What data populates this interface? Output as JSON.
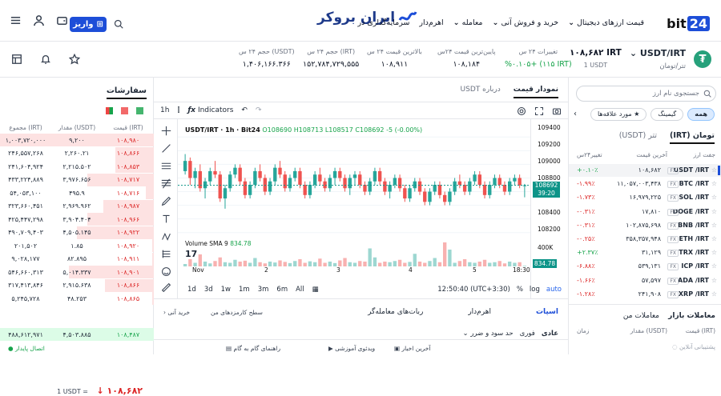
{
  "header": {
    "brand": "bit24",
    "partner_logo": "ایران بروکر",
    "menu": [
      "قیمت ارزهای دیجیتال",
      "خرید و فروش آنی",
      "معامله",
      "اهرم‌دار",
      "سرمایه‌گذاری در"
    ],
    "deposit_label": "واریز",
    "icons": [
      "menu-icon",
      "user-icon",
      "wallet-icon",
      "search-icon"
    ]
  },
  "ticker": {
    "symbol": "USDT/IRT",
    "name": "تتر/تومان",
    "price": "۱۰۸,۶۸۲ IRT",
    "price_usd": "1 USDT",
    "stats": [
      {
        "label": "تغییرات ۲۴ س",
        "value": "%۰.۱۰۵+ (۱۱۵ IRT)",
        "positive": true
      },
      {
        "label": "پایین‌ترین قیمت ۲۴س",
        "value": "۱۰۸,۱۸۴"
      },
      {
        "label": "بالاترین قیمت ۲۴ س",
        "value": "۱۰۸,۹۱۱"
      },
      {
        "label": "حجم ۲۴ س (IRT)",
        "value": "۱۵۲,۷۸۴,۷۲۹,۵۵۵"
      },
      {
        "label": "حجم ۲۴ س (USDT)",
        "value": "۱,۴۰۶,۱۶۶.۳۶۶"
      }
    ]
  },
  "orderbook": {
    "title": "سفارشات",
    "headers": [
      "قیمت (IRT)",
      "مقدار (USDT)",
      "مجموع (IRT)"
    ],
    "asks": [
      [
        "۱۰۸,۹۸۰",
        "۹,۲۰۰",
        "۱,۰۰۳,۷۲۰,۰۰۰"
      ],
      [
        "۱۰۸,۸۶۶",
        "۲,۲۶۰.۲۱",
        "۲۴۶,۵۵۷,۲۶۸"
      ],
      [
        "۱۰۸,۸۵۳",
        "۲,۲۱۵.۵۰۲",
        "۲۴۱,۶۰۴,۹۲۴"
      ],
      [
        "۱۰۸,۷۱۷",
        "۳,۹۷۶.۶۵۶",
        "۴۳۳,۲۲۴,۸۸۹"
      ],
      [
        "۱۰۸,۷۱۶",
        "۴۹۵.۹",
        "۵۴,۰۵۳,۱۰۰"
      ],
      [
        "۱۰۸,۹۸۷",
        "۲,۹۶۹.۹۶۲",
        "۳۲۳,۶۶۰,۴۵۱"
      ],
      [
        "۱۰۸,۹۶۶",
        "۳,۹۰۴.۴۰۴",
        "۴۲۵,۴۴۷,۲۹۸"
      ],
      [
        "۱۰۸,۹۲۲",
        "۴,۵۰۵.۱۴۵",
        "۴۹۰,۷۰۹,۴۰۳"
      ],
      [
        "۱۰۸,۹۲۰",
        "۱.۸۵",
        "۲۰۱,۵۰۲"
      ],
      [
        "۱۰۸,۹۱۱",
        "۸۲.۸۹۵",
        "۹,۰۲۸,۱۷۷"
      ],
      [
        "۱۰۸,۹۰۱",
        "۵,۰۱۴.۳۳۷",
        "۵۴۶,۶۶۰,۳۱۳"
      ],
      [
        "۱۰۸,۸۶۶",
        "۲,۹۱۵.۶۳۸",
        "۳۱۷,۴۱۳,۸۴۶"
      ],
      [
        "۱۰۸,۸۶۵",
        "۴۸.۲۵۳",
        "۵,۲۴۵,۷۲۸"
      ]
    ],
    "mid_price": "۱۰۸,۶۸۲",
    "mid_usdt": "1 USDT =",
    "bid": [
      "۱۰۸,۴۸۷",
      "۴,۵۰۳.۸۸۵",
      "۴۸۸,۶۱۲,۹۷۱"
    ]
  },
  "chart_panel": {
    "tabs": [
      "نمودار قیمت",
      "درباره USDT"
    ],
    "interval": "1h",
    "indicators_label": "Indicators",
    "legend": {
      "title": "USDT/IRT · 1h · Bit24",
      "o": "O108690",
      "h": "H108713",
      "l": "L108517",
      "c": "C108692",
      "chg": "-5 (-0.00%)"
    },
    "volume_legend": {
      "label": "Volume",
      "sma": "SMA 9",
      "value": "834.78"
    },
    "price_axis": [
      "109400",
      "109200",
      "109000",
      "108800",
      "108600",
      "108400",
      "108200",
      "108000"
    ],
    "current_price": "108692",
    "countdown": "39:20",
    "volume_axis": "400K",
    "volume_current": "834.78",
    "time_labels": [
      "Nov",
      "2",
      "3",
      "4",
      "5",
      "18:30"
    ],
    "ranges": [
      "1d",
      "3d",
      "1w",
      "1m",
      "3m",
      "6m",
      "All"
    ],
    "clock": "12:50:40 (UTC+3:30)",
    "percent_label": "%",
    "log_label": "log",
    "auto_label": "auto"
  },
  "chart_data": {
    "type": "candlestick",
    "ylim": [
      107950,
      109450
    ],
    "candles": [
      [
        108900,
        109150,
        108850,
        109050
      ],
      [
        109050,
        109100,
        108700,
        108800
      ],
      [
        108800,
        108950,
        108650,
        108900
      ],
      [
        108900,
        109000,
        108600,
        108650
      ],
      [
        108650,
        108800,
        108500,
        108750
      ],
      [
        108750,
        108950,
        108700,
        108900
      ],
      [
        108900,
        109050,
        108800,
        108850
      ],
      [
        108850,
        108900,
        108450,
        108500
      ],
      [
        108500,
        108700,
        108350,
        108650
      ],
      [
        108650,
        108900,
        108600,
        108850
      ],
      [
        108850,
        109000,
        108800,
        108950
      ],
      [
        108950,
        109000,
        108700,
        108750
      ],
      [
        108750,
        108800,
        108500,
        108550
      ],
      [
        108550,
        108750,
        108500,
        108700
      ],
      [
        108700,
        108950,
        108650,
        108900
      ],
      [
        108900,
        109000,
        108750,
        108800
      ],
      [
        108800,
        108850,
        108550,
        108600
      ],
      [
        108600,
        108800,
        108550,
        108750
      ],
      [
        108750,
        109000,
        108700,
        108950
      ],
      [
        108950,
        109050,
        108800,
        108850
      ],
      [
        108850,
        108900,
        108600,
        108650
      ],
      [
        108650,
        108850,
        108600,
        108800
      ],
      [
        108800,
        108950,
        108750,
        108900
      ],
      [
        108900,
        108950,
        108650,
        108700
      ],
      [
        108700,
        108750,
        108500,
        108550
      ],
      [
        108550,
        108750,
        108500,
        108700
      ],
      [
        108700,
        108900,
        108650,
        108850
      ],
      [
        108850,
        108950,
        108700,
        108750
      ],
      [
        108750,
        108800,
        108600,
        108650
      ],
      [
        108650,
        108850,
        108600,
        108800
      ],
      [
        108800,
        108950,
        108700,
        108900
      ],
      [
        108900,
        108950,
        108750,
        108800
      ],
      [
        108800,
        108850,
        108600,
        108650
      ],
      [
        108650,
        108850,
        108550,
        108800
      ],
      [
        108800,
        108900,
        108700,
        108850
      ],
      [
        108850,
        108900,
        108650,
        108700
      ],
      [
        108700,
        108750,
        108550,
        108600
      ],
      [
        108600,
        108800,
        108550,
        108750
      ],
      [
        108750,
        108950,
        108700,
        108900
      ],
      [
        108900,
        108950,
        108700,
        108750
      ],
      [
        108750,
        108800,
        108550,
        108600
      ],
      [
        108600,
        108750,
        108500,
        108700
      ],
      [
        108700,
        108850,
        108650,
        108800
      ],
      [
        108800,
        108850,
        108600,
        108650
      ],
      [
        108650,
        108700,
        108450,
        108500
      ],
      [
        108500,
        108700,
        108450,
        108650
      ],
      [
        108650,
        108800,
        108600,
        108750
      ],
      [
        108750,
        108800,
        108550,
        108600
      ],
      [
        108600,
        108650,
        108400,
        108450
      ],
      [
        108450,
        108650,
        108400,
        108600
      ],
      [
        108600,
        108750,
        108550,
        108700
      ],
      [
        108700,
        108750,
        108500,
        108550
      ],
      [
        108550,
        108600,
        108400,
        108450
      ],
      [
        108450,
        108650,
        108400,
        108600
      ],
      [
        108600,
        108800,
        108550,
        108750
      ],
      [
        108750,
        108850,
        108650,
        108700
      ],
      [
        108700,
        108750,
        108550,
        108600
      ],
      [
        108600,
        108800,
        108550,
        108750
      ],
      [
        108750,
        108900,
        108700,
        108850
      ],
      [
        108850,
        108900,
        108650,
        108700
      ],
      [
        108700,
        108750,
        108500,
        108550
      ],
      [
        108550,
        108750,
        108500,
        108700
      ],
      [
        108700,
        108850,
        108650,
        108800
      ],
      [
        108800,
        108850,
        108650,
        108700
      ],
      [
        108700,
        108750,
        108550,
        108600
      ],
      [
        108600,
        108800,
        108550,
        108750
      ],
      [
        108750,
        108850,
        108700,
        108800
      ],
      [
        108800,
        108850,
        108650,
        108692
      ],
      [
        108692,
        108713,
        108517,
        108692
      ]
    ],
    "volume": [
      40,
      120,
      60,
      200,
      80,
      50,
      90,
      150,
      70,
      60,
      110,
      80,
      95,
      60,
      140,
      70,
      50,
      80,
      65,
      100,
      75,
      55,
      90,
      120,
      60,
      85,
      70,
      130,
      60,
      80,
      55,
      100,
      140,
      70,
      60,
      90,
      80,
      300,
      150,
      60,
      80,
      70,
      90,
      110,
      60,
      75,
      210,
      80,
      60,
      90,
      140,
      70,
      400,
      280,
      60,
      90,
      120,
      70,
      60,
      80,
      110,
      60,
      70,
      90,
      50,
      80,
      60,
      70,
      10
    ],
    "colors": {
      "up": "#26a69a",
      "down": "#ef5350"
    }
  },
  "bottom": {
    "tabs": [
      "اسپات",
      "اهرم‌دار",
      "ربات‌های معامله‌گر",
      "سطح کارمزدهای من"
    ],
    "instant": "خرید آنی",
    "order_types": [
      "عادی",
      "فوری",
      "حد سود و ضرر"
    ],
    "footer": [
      "پشتیبانی آنلاین",
      "آخرین اخبار",
      "ویدئوی آموزشی",
      "راهنمای گام به گام",
      "اتصال پایدار"
    ]
  },
  "market": {
    "search_placeholder": "جستجوی نام ارز",
    "chips": [
      "همه",
      "گیمینگ",
      "مورد علاقه‌ها"
    ],
    "tabs": [
      "تومان (IRT)",
      "تتر (USDT)"
    ],
    "headers": [
      "جفت ارز",
      "آخرین قیمت",
      "تغییر۲۴س"
    ],
    "rows": [
      {
        "pair": "USDT /IRT",
        "price": "۱۰۸,۶۸۲",
        "change": "+۰.۱۰٪",
        "up": true
      },
      {
        "pair": "BTC /IRT",
        "price": "۱۱,۰۵۷,۰۰۳,۴۳۸",
        "change": "-۱.۹۹٪",
        "up": false
      },
      {
        "pair": "SOL /IRT",
        "price": "۱۶,۹۷۹,۲۲۵",
        "change": "-۱.۷۳٪",
        "up": false
      },
      {
        "pair": "DOGE /IRT",
        "price": "۱۷,۸۱۰",
        "change": "-۰.۳۱٪",
        "up": false
      },
      {
        "pair": "BNB /IRT",
        "price": "۱۰۲,۸۷۵,۶۹۸",
        "change": "-۰.۳۱٪",
        "up": false
      },
      {
        "pair": "ETH /IRT",
        "price": "۳۵۸,۳۵۷,۹۴۸",
        "change": "-۰.۲۵٪",
        "up": false
      },
      {
        "pair": "TRX /IRT",
        "price": "۳۱,۱۲۹",
        "change": "+۲.۳۷٪",
        "up": true
      },
      {
        "pair": "ICP /IRT",
        "price": "۵۳۹,۱۳۱",
        "change": "-۶.۸۸٪",
        "up": false
      },
      {
        "pair": "ADA /IRT",
        "price": "۵۷,۵۹۷",
        "change": "-۱.۶۶٪",
        "up": false
      },
      {
        "pair": "XRP /IRT",
        "price": "۲۴۱,۹۰۸",
        "change": "-۱.۲۸٪",
        "up": false
      }
    ],
    "fx_label": "FX",
    "trades_tabs": [
      "معاملات بازار",
      "معاملات من"
    ],
    "trades_headers": [
      "قیمت (IRT)",
      "مقدار (USDT)",
      "زمان"
    ]
  }
}
